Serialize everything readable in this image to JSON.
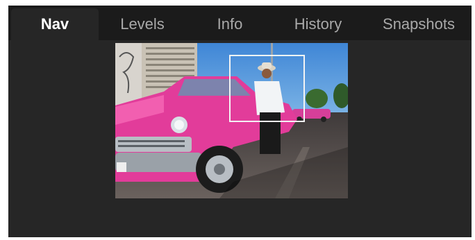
{
  "tabs": [
    {
      "label": "Nav",
      "active": true
    },
    {
      "label": "Levels",
      "active": false
    },
    {
      "label": "Info",
      "active": false
    },
    {
      "label": "History",
      "active": false
    },
    {
      "label": "Snapshots",
      "active": false
    }
  ],
  "colors": {
    "tab_bar_bg": "#1b1b1b",
    "panel_bg": "#262626",
    "active_tab_text": "#ffffff",
    "inactive_tab_text": "#a9a9a9",
    "viewport_frame": "#f4f4f4"
  }
}
